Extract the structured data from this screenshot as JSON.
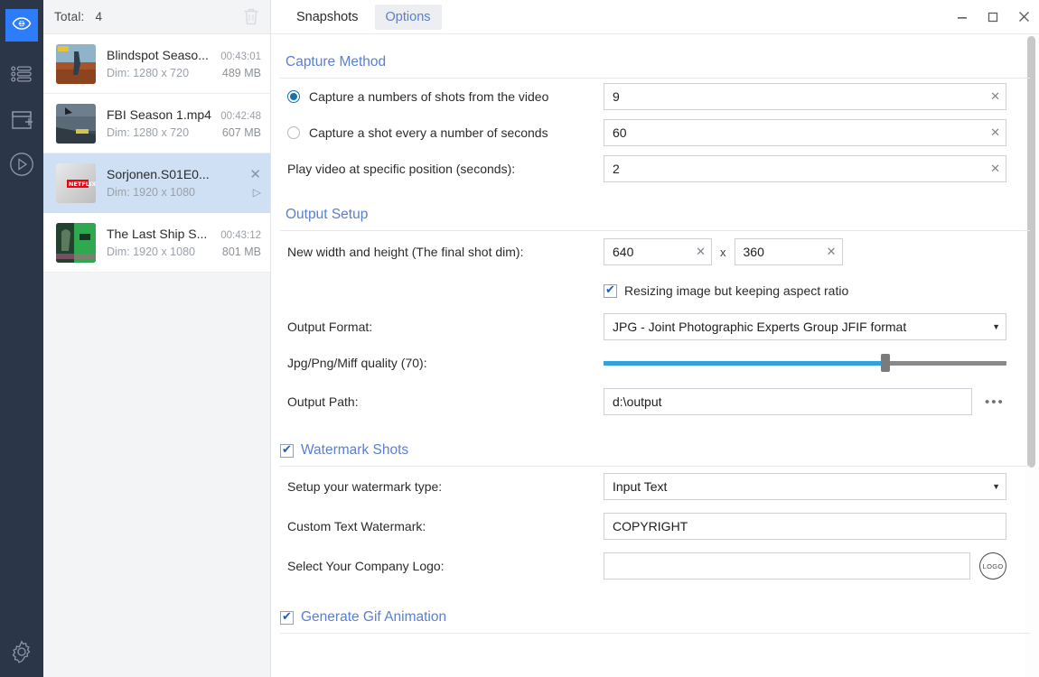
{
  "colors": {
    "rail_bg": "#2b3648",
    "rail_active": "#2d7dfb",
    "section_heading": "#5a7fd0",
    "selection": "#cfe0f5",
    "slider_fill": "#2ea3dd",
    "radio_fill": "#1a70ad"
  },
  "rail": {
    "items": [
      {
        "name": "eye-icon",
        "label": "Snapshots",
        "active": true
      },
      {
        "name": "list-icon",
        "label": "Queue",
        "active": false
      },
      {
        "name": "add-file-icon",
        "label": "Add file",
        "active": false
      },
      {
        "name": "play-circle-icon",
        "label": "Play",
        "active": false
      }
    ],
    "settings": {
      "name": "gear-icon",
      "label": "Settings"
    }
  },
  "filelist": {
    "total_label": "Total:",
    "total_count": "4",
    "trash_icon": "trash-icon",
    "items": [
      {
        "name": "Blindspot Seaso...",
        "duration": "00:43:01",
        "dim": "Dim: 1280 x 720",
        "size": "489 MB",
        "selected": false
      },
      {
        "name": "FBI Season 1.mp4",
        "duration": "00:42:48",
        "dim": "Dim: 1280 x 720",
        "size": "607 MB",
        "selected": false
      },
      {
        "name": "Sorjonen.S01E0...",
        "duration": "",
        "dim": "Dim: 1920 x 1080",
        "size": "",
        "selected": true
      },
      {
        "name": "The Last Ship S...",
        "duration": "00:43:12",
        "dim": "Dim: 1920 x 1080",
        "size": "801 MB",
        "selected": false
      }
    ]
  },
  "window": {
    "minimize": "–",
    "maximize": "□",
    "close": "✕"
  },
  "tabs": [
    {
      "label": "Snapshots",
      "active": true
    },
    {
      "label": "Options",
      "active": false
    }
  ],
  "capture_method": {
    "heading": "Capture Method",
    "option_shots_label": "Capture a numbers of shots from the video",
    "option_shots_value": "9",
    "option_seconds_label": "Capture a shot every a number of seconds",
    "option_seconds_value": "60",
    "position_label": "Play video at specific position (seconds):",
    "position_value": "2",
    "clear_glyph": "✕"
  },
  "output_setup": {
    "heading": "Output Setup",
    "dim_label": "New width and height (The final shot dim):",
    "width_value": "640",
    "height_value": "360",
    "dim_separator": "x",
    "aspect_label": "Resizing image but keeping aspect ratio",
    "aspect_checked": true,
    "format_label": "Output Format:",
    "format_value": "JPG  - Joint Photographic Experts Group JFIF format",
    "quality_label": "Jpg/Png/Miff quality (70):",
    "quality_value": "70",
    "path_label": "Output Path:",
    "path_value": "d:\\output",
    "browse_glyph": "•••"
  },
  "watermark": {
    "heading": "Watermark Shots",
    "checked": true,
    "type_label": "Setup your watermark type:",
    "type_value": "Input Text",
    "text_label": "Custom Text Watermark:",
    "text_value": "COPYRIGHT",
    "logo_label": "Select Your Company Logo:",
    "logo_value": "",
    "logo_button_text": "LOGO"
  },
  "gif": {
    "heading": "Generate Gif Animation",
    "checked": true
  }
}
